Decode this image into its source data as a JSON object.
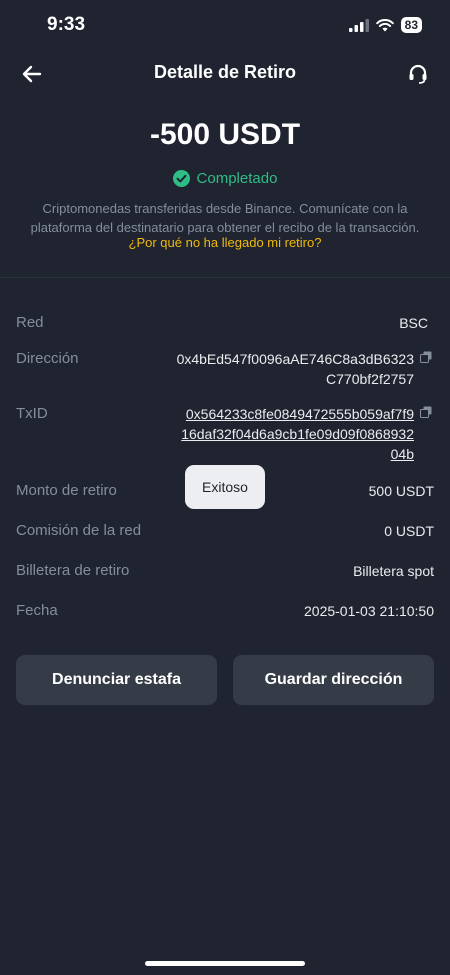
{
  "status_bar": {
    "time": "9:33",
    "battery": "83"
  },
  "header": {
    "title": "Detalle de Retiro"
  },
  "summary": {
    "amount": "-500 USDT",
    "status": "Completado",
    "description": "Criptomonedas transferidas desde Binance. Comunícate con la plataforma del destinatario para obtener el recibo de la transacción.",
    "help_link": "¿Por qué no ha llegado mi retiro?"
  },
  "details": {
    "network_label": "Red",
    "network_value": "BSC",
    "address_label": "Dirección",
    "address_line1": "0x4bEd547f0096aAE746C8a3dB6323",
    "address_line2": "C770bf2f2757",
    "txid_label": "TxID",
    "txid_line1": "0x564233c8fe0849472555b059af7f9",
    "txid_line2": "16daf32f04d6a9cb1fe09d09f0868932",
    "txid_line3": "04b",
    "amount_label": "Monto de retiro",
    "amount_value": "500 USDT",
    "fee_label": "Comisión de la red",
    "fee_value": "0 USDT",
    "wallet_label": "Billetera de retiro",
    "wallet_value": "Billetera spot",
    "date_label": "Fecha",
    "date_value": "2025-01-03 21:10:50"
  },
  "toast": {
    "text": "Exitoso"
  },
  "actions": {
    "report_label": "Denunciar estafa",
    "save_label": "Guardar dirección"
  },
  "colors": {
    "background": "#1f2430",
    "success": "#2ebd85",
    "link": "#f0b90b",
    "button": "#363c47"
  }
}
